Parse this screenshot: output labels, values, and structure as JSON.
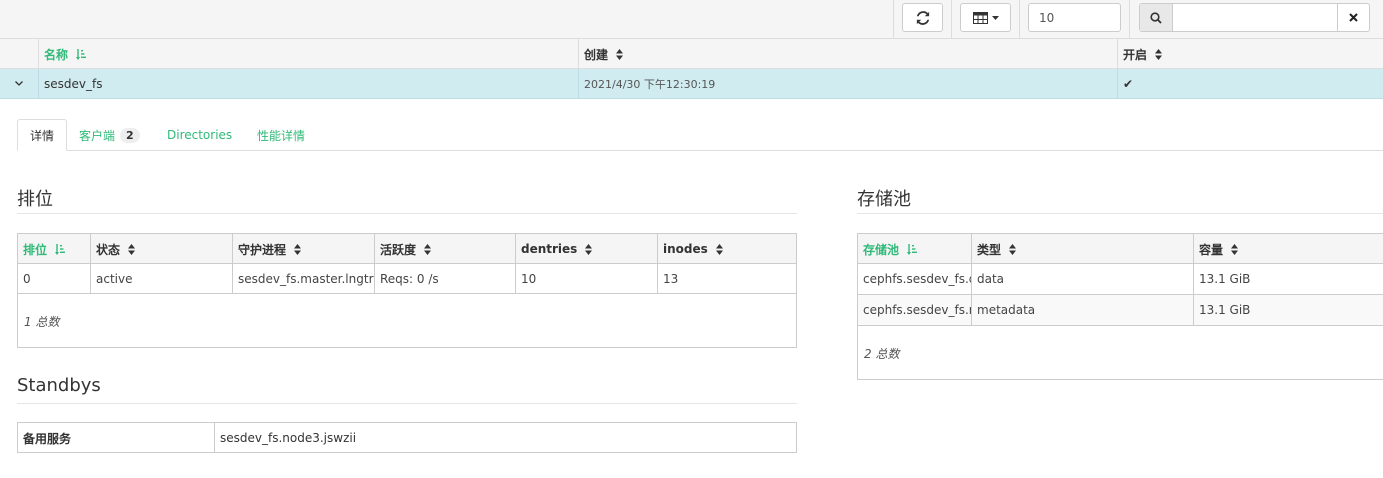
{
  "toolbar": {
    "refresh_icon": "refresh-icon",
    "columns_icon": "table-columns-icon",
    "page_size": "10",
    "search_icon": "search-icon",
    "search_value": "",
    "clear_icon": "times-icon"
  },
  "main_table": {
    "columns": [
      "名称",
      "创建",
      "开启"
    ],
    "sorted_column": "名称",
    "row": {
      "name": "sesdev_fs",
      "created": "2021/4/30 下午12:30:19",
      "enabled": "✔"
    }
  },
  "tabs": [
    {
      "label": "详情",
      "active": true
    },
    {
      "label": "客户端",
      "badge": "2"
    },
    {
      "label": "Directories"
    },
    {
      "label": "性能详情"
    }
  ],
  "ranks": {
    "title": "排位",
    "columns": [
      "排位",
      "状态",
      "守护进程",
      "活跃度",
      "dentries",
      "inodes"
    ],
    "rows": [
      [
        "0",
        "active",
        "sesdev_fs.master.lngtrl",
        "Reqs: 0 /s",
        "10",
        "13"
      ]
    ],
    "footer": "1 总数"
  },
  "pools": {
    "title": "存储池",
    "columns": [
      "存储池",
      "类型",
      "容量"
    ],
    "rows": [
      [
        "cephfs.sesdev_fs.d",
        "data",
        "13.1 GiB"
      ],
      [
        "cephfs.sesdev_fs.m",
        "metadata",
        "13.1 GiB"
      ]
    ],
    "footer": "2 总数"
  },
  "standbys": {
    "title": "Standbys",
    "label": "备用服务",
    "value": "sesdev_fs.node3.jswzii"
  },
  "colors": {
    "accent": "#30ba78",
    "selected_row": "#d1ecf1"
  }
}
